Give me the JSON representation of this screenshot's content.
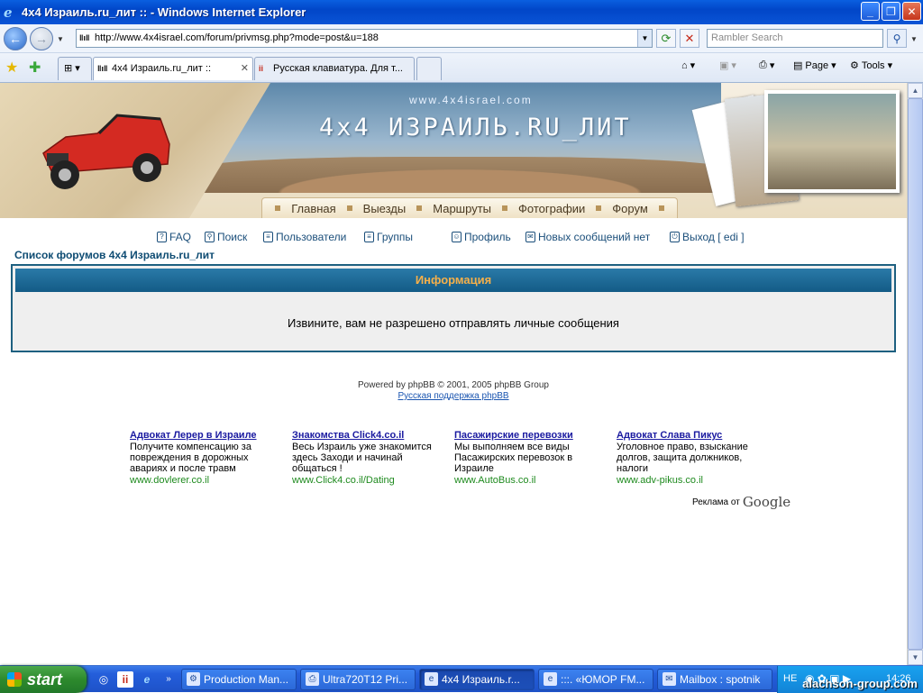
{
  "window": {
    "title": "4x4 Израиль.ru_лит :: - Windows Internet Explorer"
  },
  "address": {
    "url": "http://www.4x4israel.com/forum/privmsg.php?mode=post&u=188"
  },
  "search": {
    "placeholder": "Rambler Search"
  },
  "tabs": [
    {
      "label": "4x4 Израиль.ru_лит ::"
    },
    {
      "label": "Русская клавиатура. Для т..."
    }
  ],
  "commands": {
    "page": "Page",
    "tools": "Tools"
  },
  "site": {
    "url": "www.4x4israel.com",
    "title": "4x4 ИЗРАИЛЬ.RU_ЛИТ",
    "menu": [
      "Главная",
      "Выезды",
      "Маршруты",
      "Фотографии",
      "Форум"
    ]
  },
  "forum_nav": {
    "faq": "FAQ",
    "search": "Поиск",
    "users": "Пользователи",
    "groups": "Группы",
    "profile": "Профиль",
    "new_messages": "Новых сообщений нет",
    "logout": "Выход [ edi ]"
  },
  "breadcrumb": "Список форумов 4x4 Израиль.ru_лит",
  "info": {
    "header": "Информация",
    "message": "Извините, вам не разрешено отправлять личные сообщения"
  },
  "footer": {
    "powered": "Powered by phpBB © 2001, 2005 phpBB Group",
    "support": "Русская поддержка phpBB"
  },
  "ads": [
    {
      "title": "Адвокат Лерер в Израиле",
      "text": "Получите компенсацию за повреждения в дорожных авариях и после травм",
      "url": "www.dovlerer.co.il"
    },
    {
      "title": "Знакомства Click4.co.il",
      "text": "Весь Израиль уже знакомится здесь Заходи и начинай общаться !",
      "url": "www.Click4.co.il/Dating"
    },
    {
      "title": "Пасажирские перевозки",
      "text": "Мы выполняем все виды Пасажирских перевозок в Израиле",
      "url": "www.AutoBus.co.il"
    },
    {
      "title": "Адвокат Слава Пикус",
      "text": "Уголовное право, взыскание долгов, защита должников, налоги",
      "url": "www.adv-pikus.co.il"
    }
  ],
  "ads_by": {
    "label": "Реклама от",
    "brand": "Google"
  },
  "taskbar": {
    "start": "start",
    "tasks": [
      "Production Man...",
      "Ultra720T12 Pri...",
      "4x4 Израиль.r...",
      ":::. «ЮМОР FM...",
      "Mailbox : spotnik"
    ],
    "lang": "НЕ",
    "clock": "14:26"
  },
  "watermark": "alachson-group.com"
}
